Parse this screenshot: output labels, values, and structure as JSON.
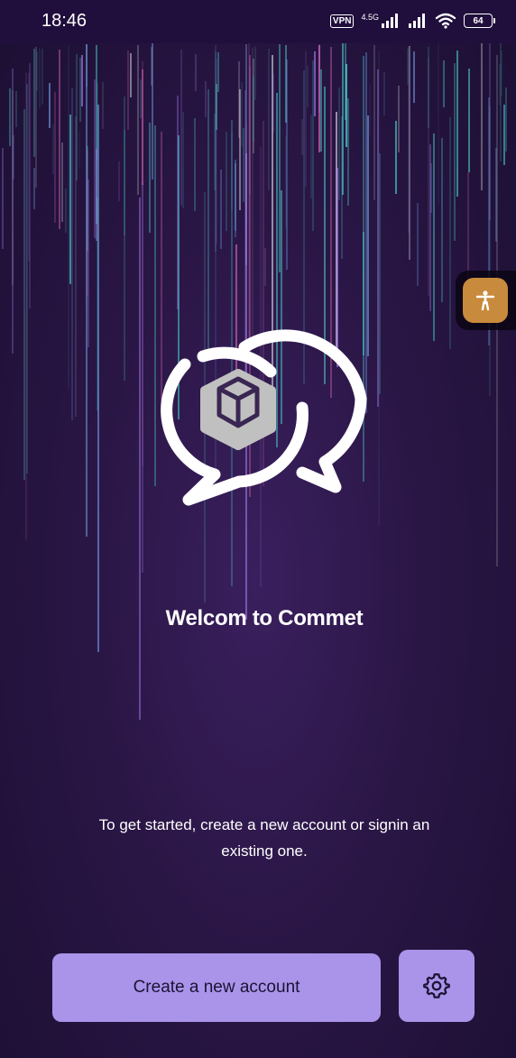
{
  "status_bar": {
    "time": "18:46",
    "vpn_label": "VPN",
    "network_type": "4.5G",
    "battery_level": "64"
  },
  "welcome": {
    "title": "Welcom to Commet",
    "subtitle": "To get started, create a new account or signin an existing one."
  },
  "actions": {
    "create_account_label": "Create a new account",
    "settings_icon": "gear-icon"
  },
  "icons": {
    "logo": "chat-bubbles-cube-logo",
    "accessibility": "accessibility-person-icon",
    "signal": "signal-bars-icon",
    "wifi": "wifi-icon"
  },
  "colors": {
    "background": "#2a1645",
    "status_bar": "#200f3c",
    "button": "#a994ea",
    "accessibility": "#c88a3c",
    "rain_teal": "#4fe3d8",
    "rain_pink": "#e86fc0"
  }
}
